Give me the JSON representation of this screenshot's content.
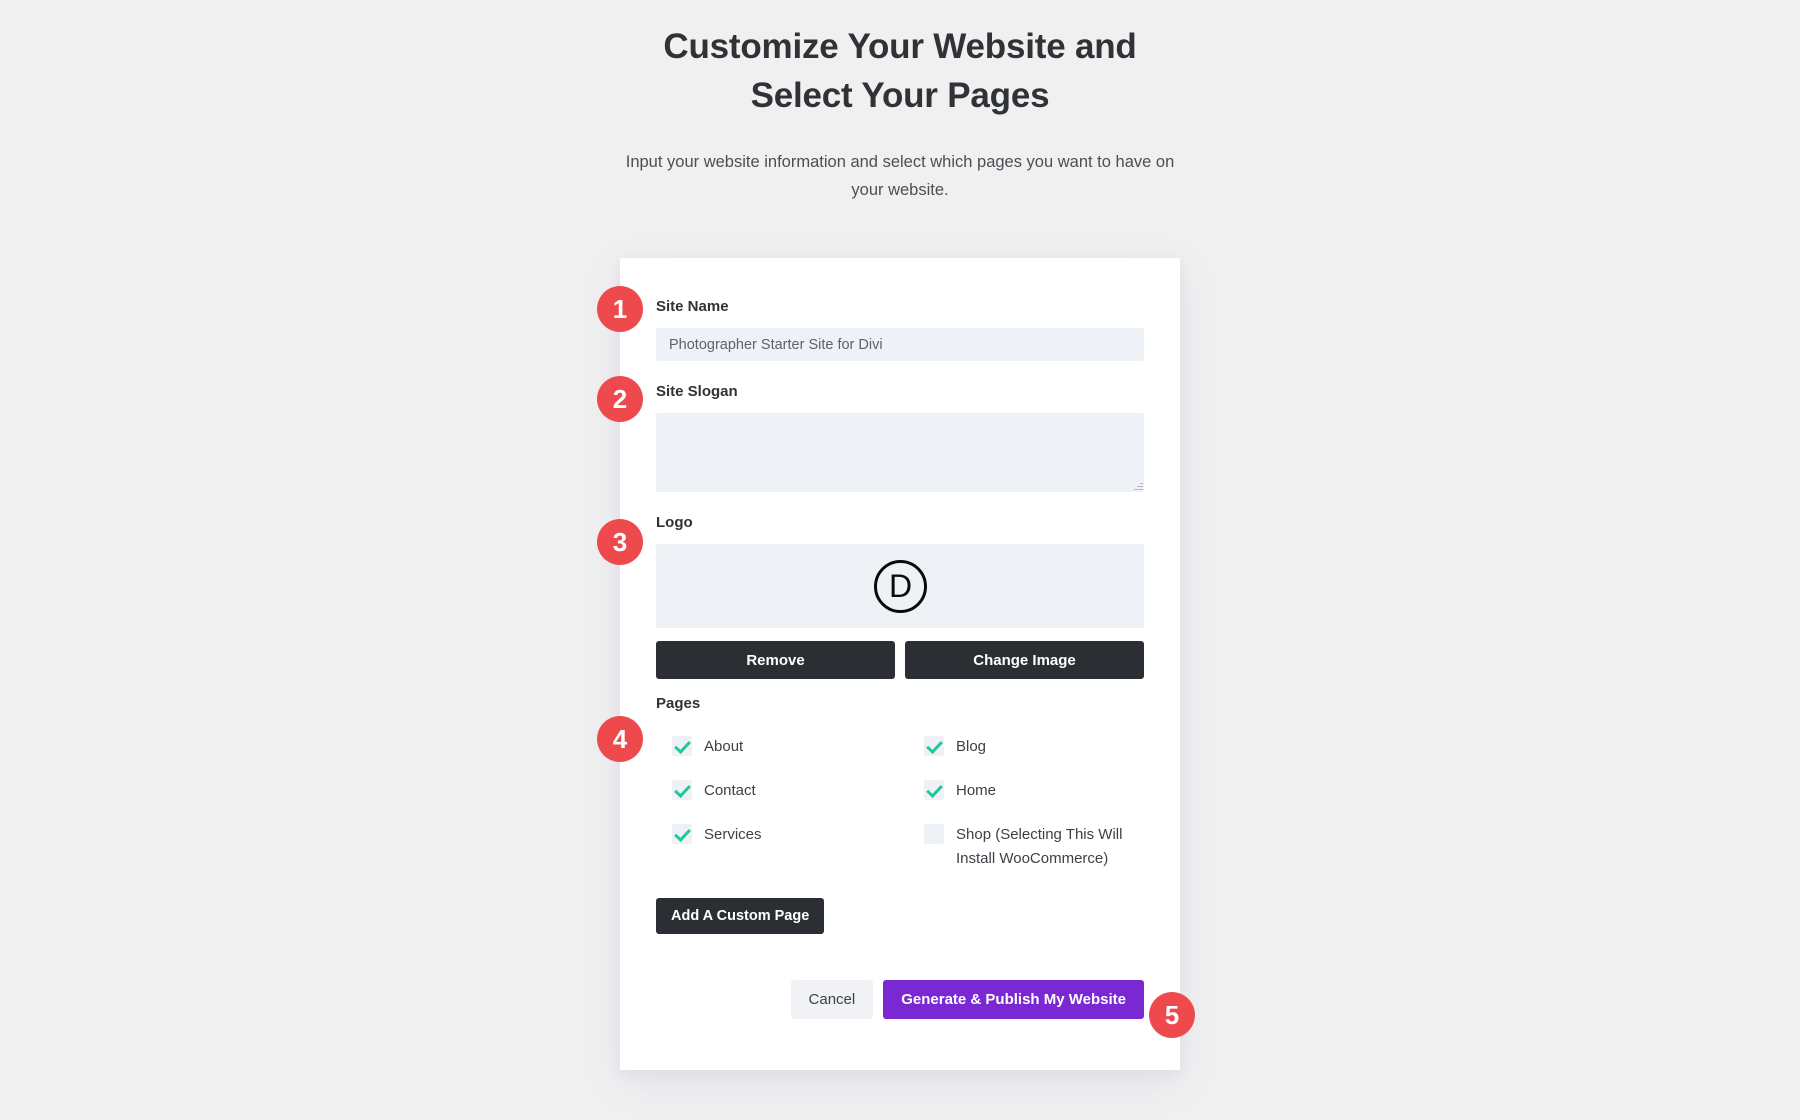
{
  "header": {
    "title": "Customize Your Website and Select Your Pages",
    "subtitle": "Input your website information and select which pages you want to have on your website."
  },
  "steps": {
    "one": "1",
    "two": "2",
    "three": "3",
    "four": "4",
    "five": "5"
  },
  "form": {
    "site_name": {
      "label": "Site Name",
      "value": "Photographer Starter Site for Divi",
      "placeholder": ""
    },
    "site_slogan": {
      "label": "Site Slogan",
      "value": "",
      "placeholder": ""
    },
    "logo": {
      "label": "Logo",
      "mark": "D",
      "remove_label": "Remove",
      "change_label": "Change Image"
    },
    "pages": {
      "label": "Pages",
      "options": [
        {
          "label": "About",
          "checked": true
        },
        {
          "label": "Blog",
          "checked": true
        },
        {
          "label": "Contact",
          "checked": true
        },
        {
          "label": "Home",
          "checked": true
        },
        {
          "label": "Services",
          "checked": true
        },
        {
          "label": "Shop (Selecting This Will Install WooCommerce)",
          "checked": false
        }
      ],
      "add_custom_page_label": "Add A Custom Page"
    }
  },
  "footer": {
    "cancel_label": "Cancel",
    "generate_label": "Generate & Publish My Website"
  },
  "colors": {
    "background": "#f0f0f0",
    "card": "#ffffff",
    "badge_red": "#ee4a4d",
    "accent_purple": "#7928d2",
    "dark_button": "#2b2f33",
    "input_background": "#eef2f6",
    "check_green": "#20c997"
  }
}
